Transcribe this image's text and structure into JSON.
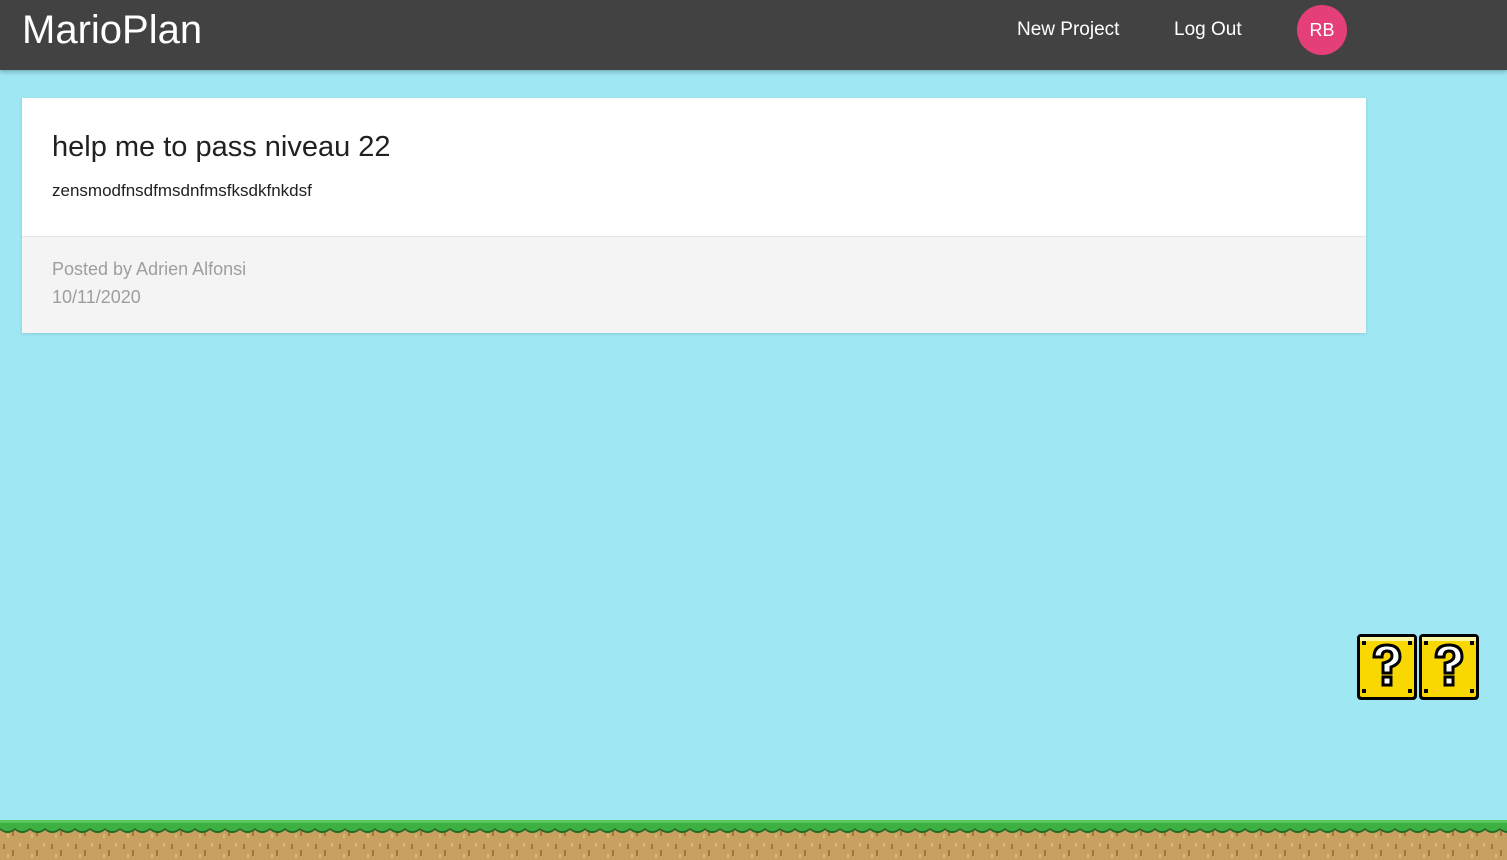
{
  "nav": {
    "brand": "MarioPlan",
    "links": [
      "New Project",
      "Log Out"
    ],
    "avatar_initials": "RB",
    "background_color": "#424242",
    "avatar_color": "#e53f7a"
  },
  "project": {
    "title": "help me to pass niveau 22",
    "content": "zensmodfnsdfmsdnfmsfksdkfnkdsf",
    "author_line": "Posted by Adrien Alfonsi",
    "date": "10/11/2020"
  },
  "decorations": {
    "page_background": "#9fe7f2",
    "question_blocks": [
      "question-block-icon",
      "question-block-icon"
    ],
    "ground": "grass-ground"
  }
}
